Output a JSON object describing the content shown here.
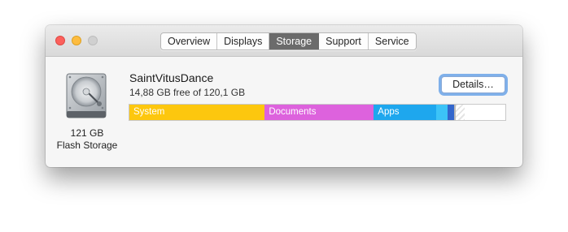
{
  "window": {
    "tabs": [
      {
        "label": "Overview",
        "active": false
      },
      {
        "label": "Displays",
        "active": false
      },
      {
        "label": "Storage",
        "active": true
      },
      {
        "label": "Support",
        "active": false
      },
      {
        "label": "Service",
        "active": false
      }
    ]
  },
  "drive": {
    "icon": "hard-drive-icon",
    "capacity_label": "121 GB",
    "type_label": "Flash Storage"
  },
  "disk": {
    "name": "SaintVitusDance",
    "free_text": "14,88 GB free of 120,1 GB",
    "details_button": "Details…"
  },
  "storage_bar": {
    "segments": [
      {
        "label": "System",
        "fraction": 0.36,
        "color": "#fdc70e"
      },
      {
        "label": "Documents",
        "fraction": 0.29,
        "color": "#dd62dd"
      },
      {
        "label": "Apps",
        "fraction": 0.167,
        "color": "#1ea7ee"
      },
      {
        "label": "",
        "fraction": 0.03,
        "color": "#3cc3f7"
      },
      {
        "label": "",
        "fraction": 0.017,
        "color": "#3366cc"
      },
      {
        "label": "",
        "fraction": 0.005,
        "color": "#b8b8b8"
      },
      {
        "label": "",
        "fraction": 0.022,
        "color": "hatch"
      },
      {
        "label": "",
        "fraction": 0.109,
        "color": "#ffffff"
      }
    ]
  }
}
